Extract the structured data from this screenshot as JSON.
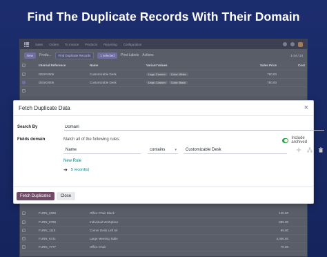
{
  "banner": {
    "title": "Find The Duplicate Records With Their Domain"
  },
  "app": {
    "menu": [
      "Sales",
      "Orders",
      "To Invoice",
      "Products",
      "Reporting",
      "Configuration"
    ],
    "controls": {
      "new_label": "New",
      "breadcrumb": "Produ...",
      "find_dup_label": "Find Duplicate Records",
      "selected_label": "1 selected",
      "print_labels_label": "Print Labels",
      "actions_label": "Actions",
      "pager": "1-24 / 24"
    },
    "table": {
      "headers": [
        "Internal Reference",
        "Name",
        "Variant Values",
        "Sales Price",
        "Cost"
      ],
      "rows_top": [
        {
          "ref": "DESK0005",
          "name": "Customizable Desk",
          "tags": [
            "Legs: Custom",
            "Color: White"
          ],
          "price": "750.00",
          "cost": "",
          "checked": false
        },
        {
          "ref": "DESK0006",
          "name": "Customizable Desk",
          "tags": [
            "Legs: Custom",
            "Color: Black"
          ],
          "price": "750.00",
          "cost": "",
          "checked": true
        },
        {
          "ref": "",
          "name": "",
          "tags": [],
          "price": "",
          "cost": "",
          "checked": false
        }
      ],
      "rows_bottom": [
        {
          "ref": "FURN_0269",
          "name": "Office Chair Black",
          "price": "120.50",
          "cost": ""
        },
        {
          "ref": "FURN_8789",
          "name": "Individual Workplace",
          "price": "885.00",
          "cost": ""
        },
        {
          "ref": "FURN_1118",
          "name": "Corner Desk Left Sit",
          "price": "85.00",
          "cost": ""
        },
        {
          "ref": "FURN_6741",
          "name": "Large Meeting Table",
          "price": "4,000.00",
          "cost": ""
        },
        {
          "ref": "FURN_7777",
          "name": "Office Chair",
          "price": "70.00",
          "cost": ""
        }
      ]
    }
  },
  "modal": {
    "title": "Fetch Duplicate Data",
    "search_by_label": "Search By",
    "search_by_value": "Domain",
    "fields_domain_label": "Fields domain",
    "match_text": "Match all of the following rules:",
    "include_archived_label": "Include archived",
    "rule": {
      "field": "Name",
      "operator": "contains",
      "value": "Customizable Desk"
    },
    "new_rule_label": "New Rule",
    "records_label": "5 record(s)",
    "fetch_button_label": "Fetch Duplicates",
    "close_button_label": "Close"
  },
  "colors": {
    "background": "#1c2d6e",
    "primary": "#714b67",
    "link": "#017e84",
    "toggle_on": "#28a745"
  }
}
